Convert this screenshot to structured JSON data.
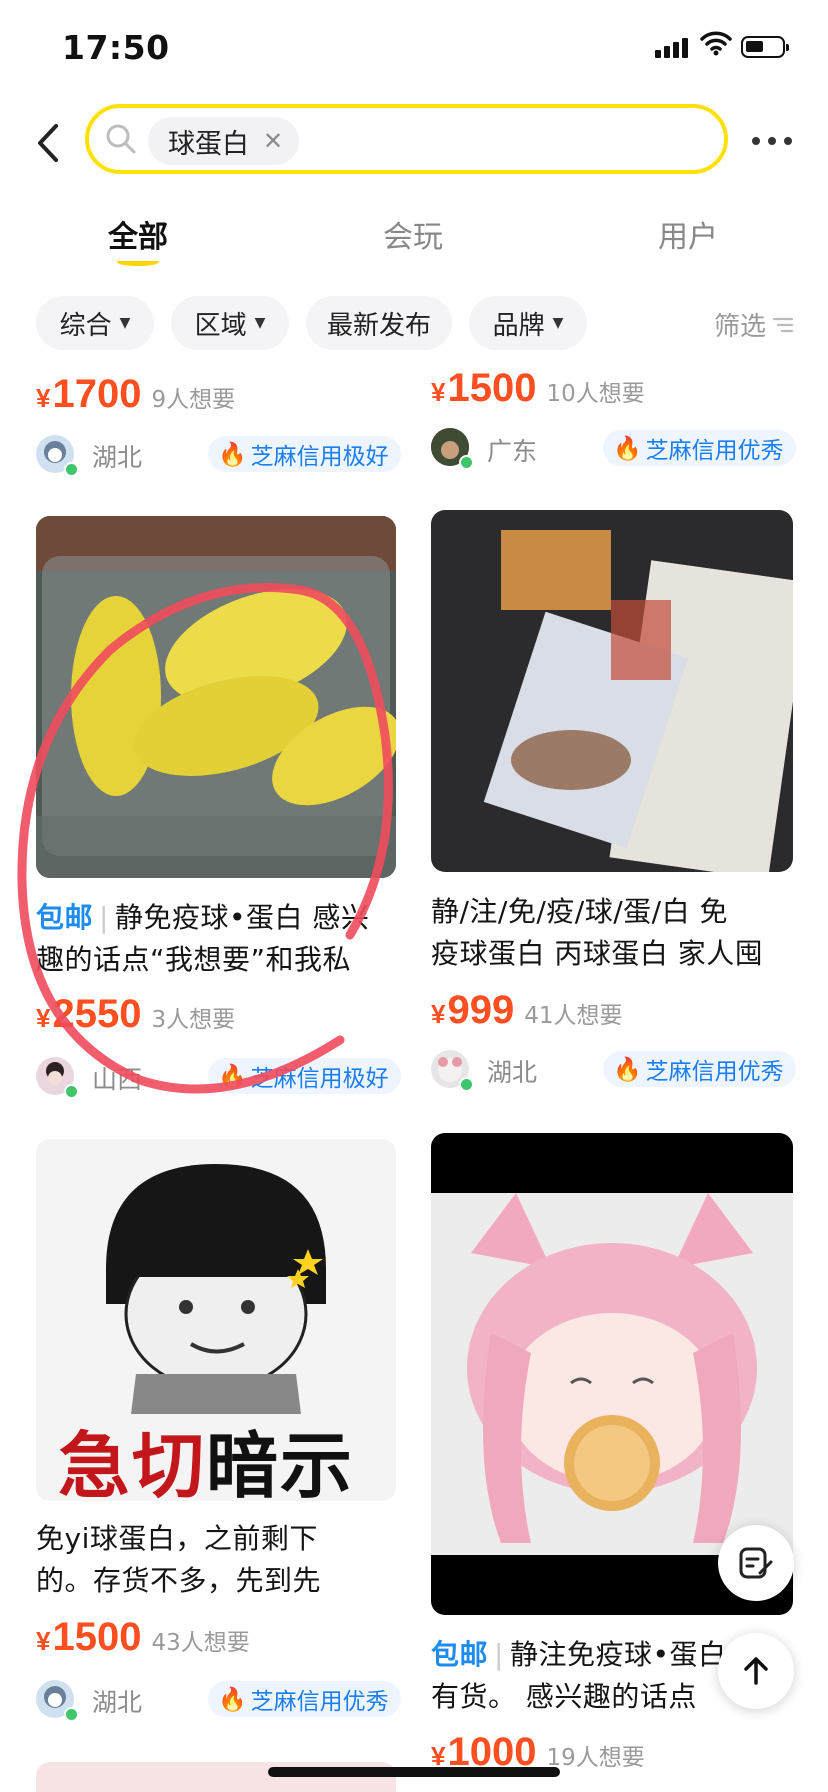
{
  "status_bar": {
    "time": "17:50"
  },
  "search": {
    "query": "球蛋白"
  },
  "tabs": [
    {
      "label": "全部",
      "active": true
    },
    {
      "label": "会玩",
      "active": false
    },
    {
      "label": "用户",
      "active": false
    }
  ],
  "filters": [
    {
      "label": "综合",
      "has_caret": true
    },
    {
      "label": "区域",
      "has_caret": true
    },
    {
      "label": "最新发布",
      "has_caret": false
    },
    {
      "label": "品牌",
      "has_caret": true
    }
  ],
  "filter_screen": "筛选",
  "currency": "¥",
  "items": [
    {
      "price": "1700",
      "wants": "9人想要",
      "location": "湖北",
      "credit": "芝麻信用极好"
    },
    {
      "price": "1500",
      "wants": "10人想要",
      "location": "广东",
      "credit": "芝麻信用优秀"
    },
    {
      "tag": "包邮",
      "title_line1": "静免疫球•蛋白 感兴",
      "title_line2": "趣的话点“我想要”和我私",
      "price": "2550",
      "wants": "3人想要",
      "location": "山西",
      "credit": "芝麻信用极好"
    },
    {
      "title_line1": "静/注/免/疫/球/蛋/白 免",
      "title_line2": "疫球蛋白 丙球蛋白 家人囤",
      "price": "999",
      "wants": "41人想要",
      "location": "湖北",
      "credit": "芝麻信用优秀"
    },
    {
      "image_text": [
        "急切",
        "暗示"
      ],
      "title_line1": "免yi球蛋白，之前剩下",
      "title_line2": "的。存货不多，先到先",
      "price": "1500",
      "wants": "43人想要",
      "location": "湖北",
      "credit": "芝麻信用优秀"
    },
    {
      "tag": "包邮",
      "title_line1": "静注免疫球•蛋白",
      "title_line2": "有货。 感兴趣的话点",
      "price": "1000",
      "wants": "19人想要"
    }
  ],
  "colors": {
    "accent_yellow": "#ffe10a",
    "price_orange": "#ff4e1f",
    "credit_blue": "#1b7ef0",
    "annotation_red": "#ef4b5c"
  }
}
